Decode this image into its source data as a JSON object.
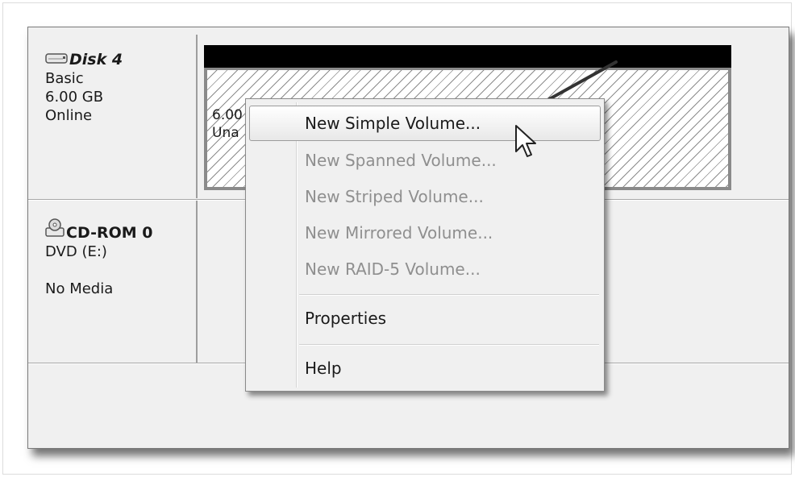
{
  "disks": [
    {
      "name": "Disk 4",
      "icon": "hard-disk-icon",
      "type": "Basic",
      "size": "6.00 GB",
      "status": "Online",
      "volume": {
        "size_text": "6.00",
        "state_text": "Una"
      }
    },
    {
      "name": "CD-ROM 0",
      "icon": "cd-rom-icon",
      "drive": "DVD (E:)",
      "media": "No Media"
    }
  ],
  "context_menu": {
    "items": [
      {
        "label": "New Simple Volume...",
        "enabled": true,
        "selected": true
      },
      {
        "label": "New Spanned Volume...",
        "enabled": false
      },
      {
        "label": "New Striped Volume...",
        "enabled": false
      },
      {
        "label": "New Mirrored Volume...",
        "enabled": false
      },
      {
        "label": "New RAID-5 Volume...",
        "enabled": false
      },
      {
        "label": "Properties",
        "enabled": true
      },
      {
        "label": "Help",
        "enabled": true
      }
    ]
  },
  "colors": {
    "volume_header": "#000000",
    "disabled_text": "#8f8f8f",
    "annotation_arrow": "#333333"
  }
}
